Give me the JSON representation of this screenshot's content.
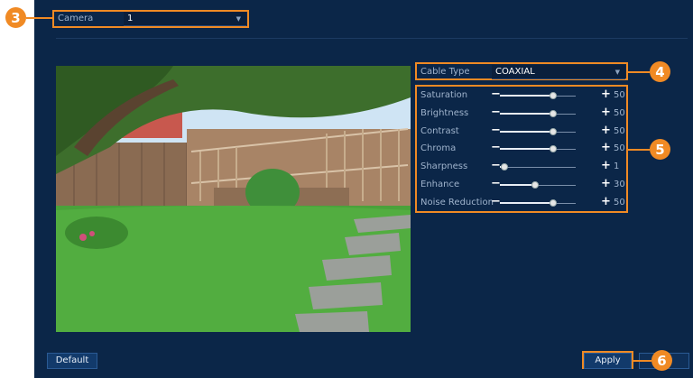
{
  "callouts": [
    "3",
    "4",
    "5",
    "6"
  ],
  "camera": {
    "label": "Camera",
    "value": "1"
  },
  "cable_type": {
    "label": "Cable Type",
    "value": "COAXIAL"
  },
  "sliders": [
    {
      "name": "Saturation",
      "value": "50",
      "level": 50
    },
    {
      "name": "Brightness",
      "value": "50",
      "level": 50
    },
    {
      "name": "Contrast",
      "value": "50",
      "level": 50
    },
    {
      "name": "Chroma",
      "value": "50",
      "level": 50
    },
    {
      "name": "Sharpness",
      "value": "1",
      "level": 1
    },
    {
      "name": "Enhance",
      "value": "30",
      "level": 30
    },
    {
      "name": "Noise Reduction",
      "value": "50",
      "level": 50
    }
  ],
  "buttons": {
    "default": "Default",
    "apply": "Apply"
  },
  "colors": {
    "accent": "#f08a24",
    "panel": "#0b2648"
  }
}
